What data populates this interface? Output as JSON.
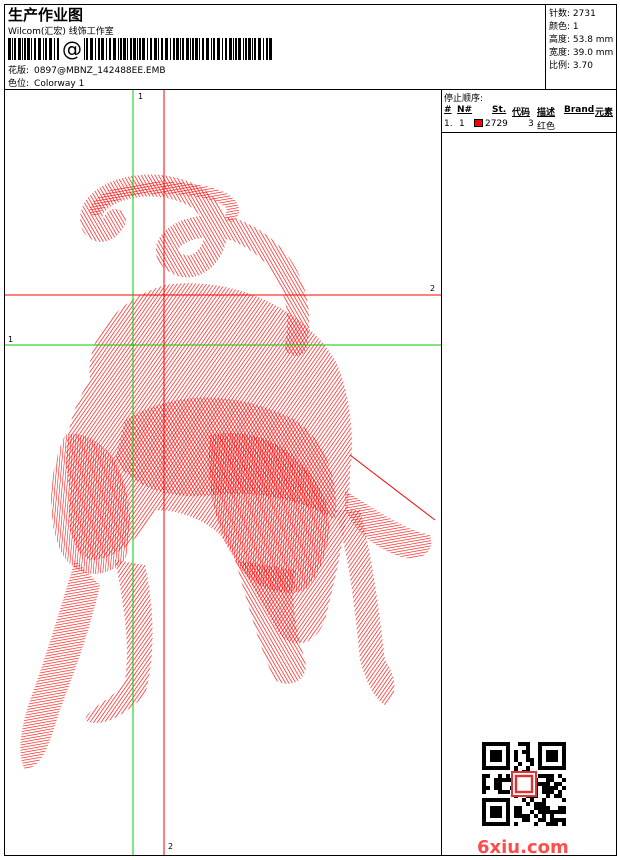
{
  "header": {
    "title": "生产作业图",
    "software": "Wilcom(汇宏) 线饰工作室",
    "barcode_symbol": "@",
    "design_label": "花版:",
    "design_value": "0897@MBNZ_142488EE.EMB",
    "colorway_label": "色位:",
    "colorway_value": "Colorway 1"
  },
  "stats": {
    "stitches": "针数: 2731",
    "colors": "颜色: 1",
    "height": "高度: 53.8 mm",
    "width": "宽度: 39.0 mm",
    "ratio": "比例: 3.70"
  },
  "stop_sequence": {
    "title": "停止顺序:",
    "headers": [
      "#",
      "N#",
      "St.",
      "代码",
      "描述",
      "Brand",
      "元素"
    ],
    "rows": [
      {
        "index": "1.",
        "n": "1",
        "stitches": "2729",
        "code": "3",
        "description": "红色",
        "color": "#ff0000"
      }
    ]
  },
  "guides": {
    "label_top_left": "1",
    "label_left": "1",
    "label_right": "2",
    "label_bottom": "2",
    "green_color": "#00cc00",
    "red_color": "#ff0000"
  },
  "design_preview": {
    "name": "red-bull-embroidery",
    "thread_color": "#ff0000"
  },
  "watermark": {
    "text": "6xiu.com"
  }
}
